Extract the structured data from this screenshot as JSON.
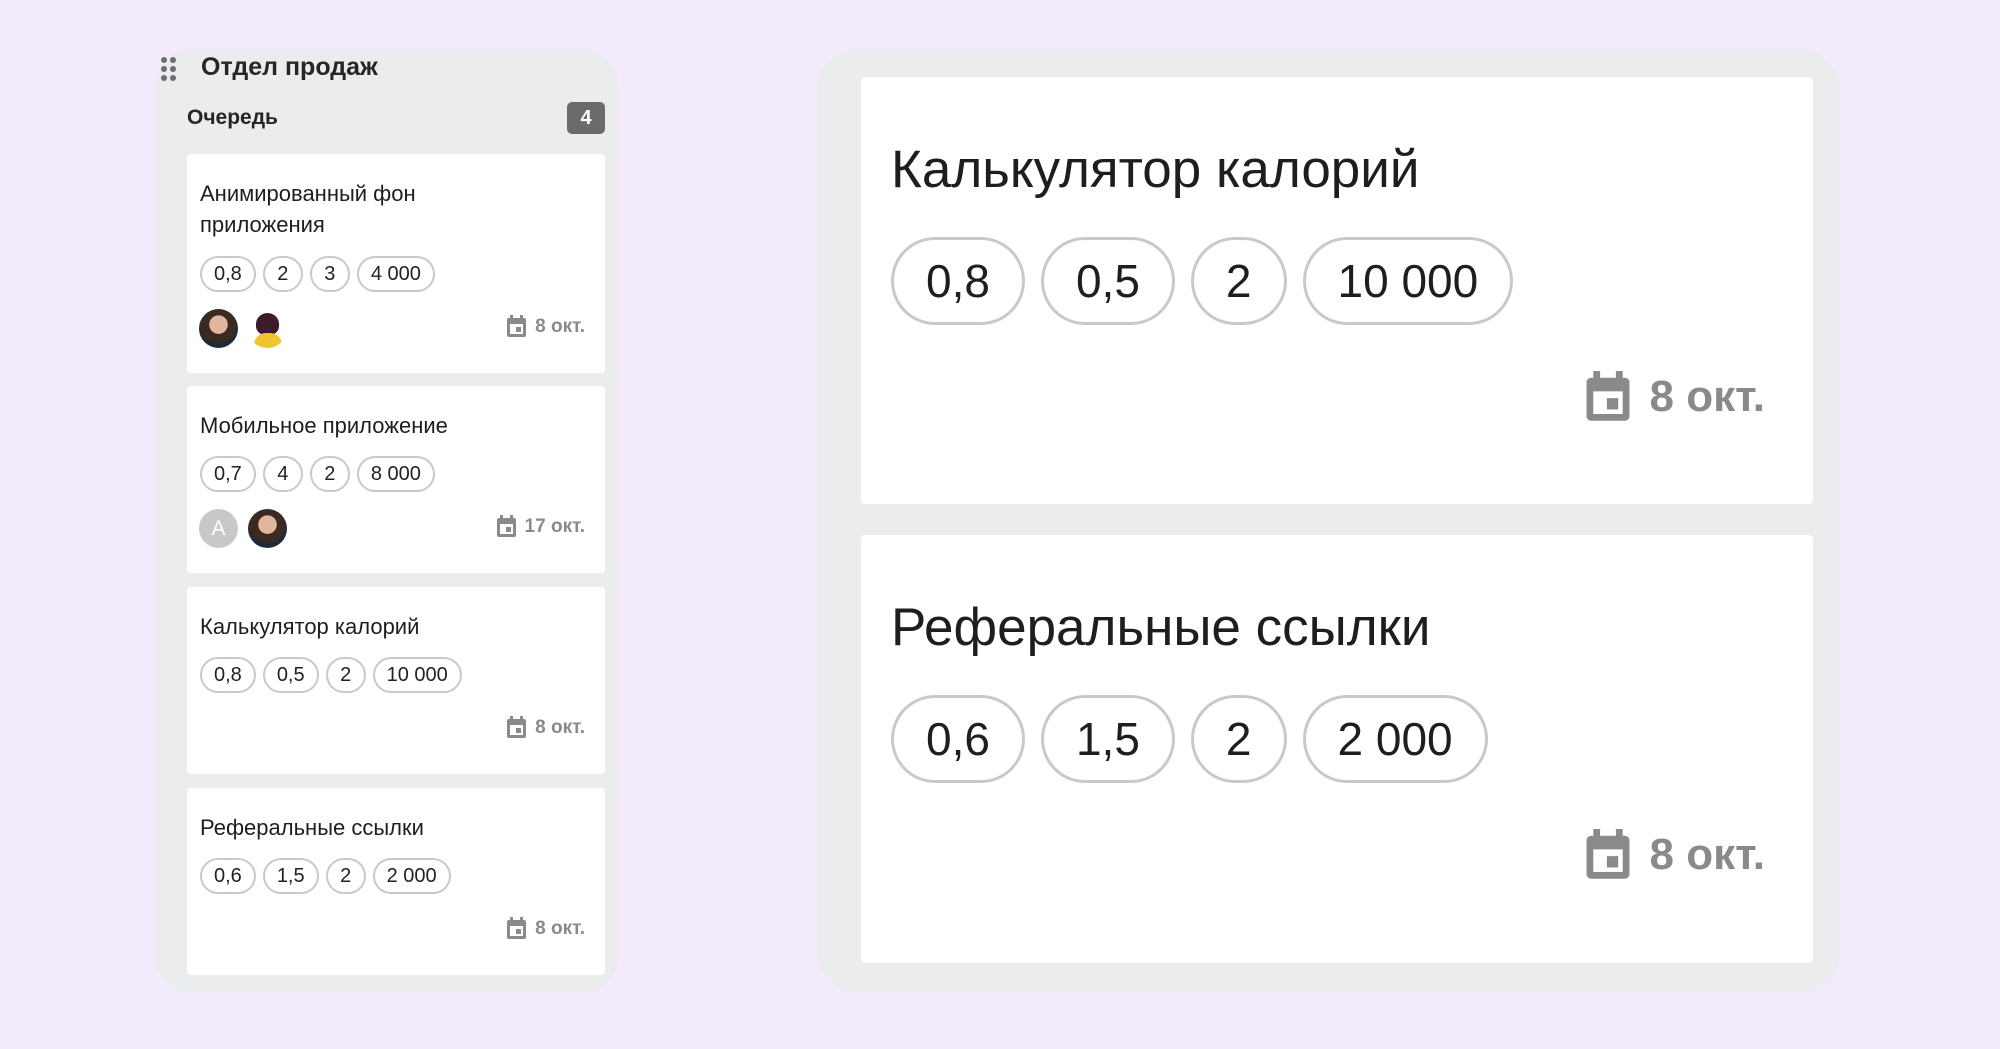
{
  "column": {
    "title": "Отдел продаж",
    "stage": "Очередь",
    "count": "4"
  },
  "cards": [
    {
      "title": "Анимированный фон приложения",
      "chips": [
        "0,8",
        "2",
        "3",
        "4 000"
      ],
      "avatars": [
        "photo-boy",
        "photo-girl"
      ],
      "date": "8 окт."
    },
    {
      "title": "Мобильное приложение",
      "chips": [
        "0,7",
        "4",
        "2",
        "8 000"
      ],
      "avatars": [
        "letter-A",
        "photo-boy"
      ],
      "avatar_letter": "A",
      "date": "17 окт."
    },
    {
      "title": "Калькулятор калорий",
      "chips": [
        "0,8",
        "0,5",
        "2",
        "10 000"
      ],
      "date": "8 окт."
    },
    {
      "title": "Реферальные ссылки",
      "chips": [
        "0,6",
        "1,5",
        "2",
        "2 000"
      ],
      "date": "8 окт."
    }
  ],
  "zoom": [
    {
      "title": "Калькулятор калорий",
      "chips": [
        "0,8",
        "0,5",
        "2",
        "10 000"
      ],
      "date": "8 окт."
    },
    {
      "title": "Реферальные ссылки",
      "chips": [
        "0,6",
        "1,5",
        "2",
        "2 000"
      ],
      "date": "8 окт."
    }
  ],
  "icons": {
    "drag": "drag-handle-icon",
    "calendar": "calendar-icon"
  },
  "colors": {
    "background": "#f3eafc",
    "panel": "#eaeced",
    "badge": "#6b6b6b",
    "date": "#8a8a8a"
  }
}
